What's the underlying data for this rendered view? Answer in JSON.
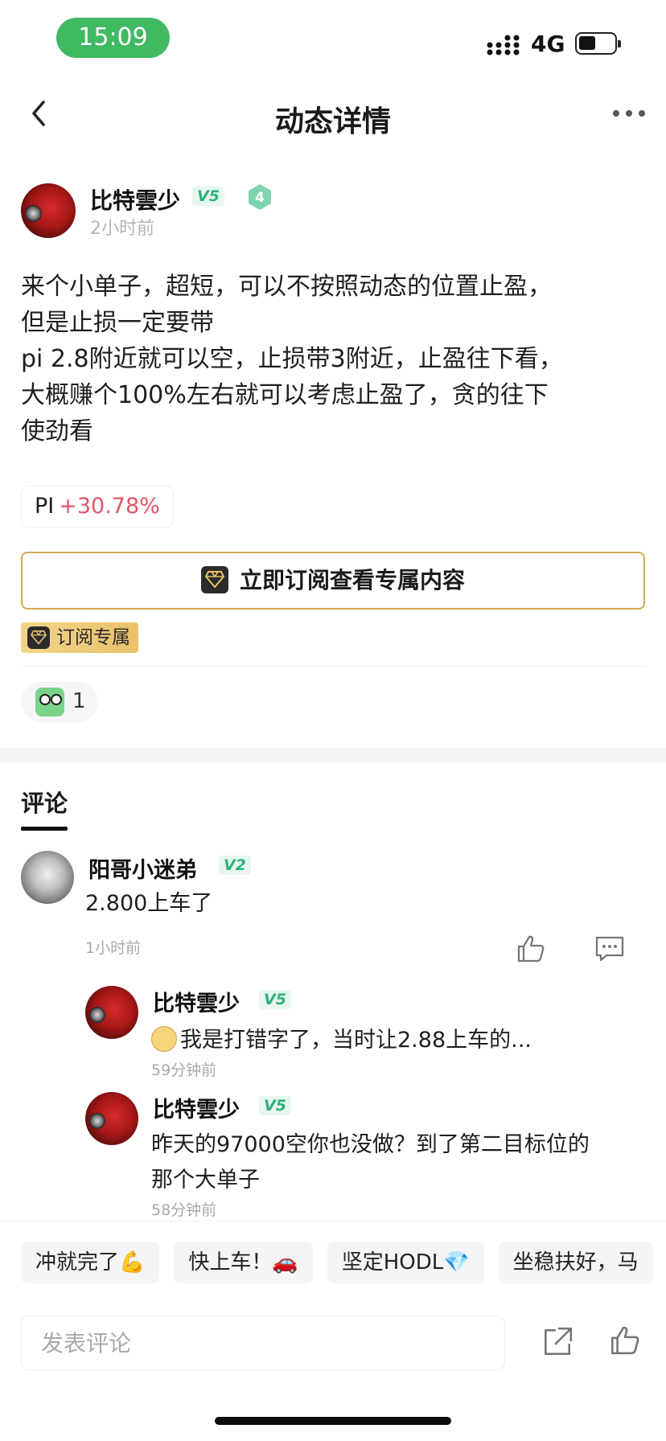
{
  "status_bar": {
    "time": "15:09",
    "network": "4G"
  },
  "nav": {
    "title": "动态详情"
  },
  "post": {
    "author": "比特雲少",
    "vip": "V5",
    "level": "4",
    "time": "2小时前",
    "content": "来个小单子，超短，可以不按照动态的位置止盈，\n但是止损一定要带\npi 2.8附近就可以空，止损带3附近，止盈往下看，\n大概赚个100%左右就可以考虑止盈了，贪的往下\n使劲看",
    "coin": {
      "symbol": "PI",
      "change": "+30.78%"
    },
    "subscribe_label": "立即订阅查看专属内容",
    "subscriber_badge": "订阅专属",
    "reaction_count": "1"
  },
  "comments": {
    "tab_label": "评论",
    "items": [
      {
        "author": "阳哥小迷弟",
        "vip": "V2",
        "text": "2.800上车了",
        "time": "1小时前",
        "replies": [
          {
            "author": "比特雲少",
            "vip": "V5",
            "text": "我是打错字了，当时让2.88上车的...",
            "time": "59分钟前"
          },
          {
            "author": "比特雲少",
            "vip": "V5",
            "text": "昨天的97000空你也没做？到了第二目标位的\n那个大单子",
            "time": "58分钟前"
          }
        ]
      }
    ]
  },
  "quick_replies": [
    "冲就完了💪",
    "快上车！🚗",
    "坚定HODL💎",
    "坐稳扶好，马"
  ],
  "comment_input": {
    "placeholder": "发表评论"
  },
  "colors": {
    "accent_green": "#3fba63",
    "vip_green": "#2fb07a",
    "positive_red": "#e05567",
    "gold": "#cfa95a"
  }
}
